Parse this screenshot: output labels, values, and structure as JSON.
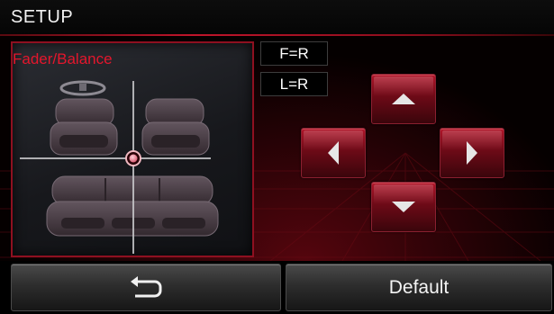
{
  "header": {
    "title": "SETUP"
  },
  "fader_panel": {
    "title": "Fader/Balance"
  },
  "status": {
    "fader": "F=R",
    "balance": "L=R"
  },
  "controls": {
    "up": "up-arrow-icon",
    "down": "down-arrow-icon",
    "left": "left-arrow-icon",
    "right": "right-arrow-icon"
  },
  "footer": {
    "back_icon": "return-icon",
    "default_label": "Default"
  },
  "colors": {
    "accent": "#e4162c",
    "border_red": "#8e1020",
    "background": "#000000"
  }
}
